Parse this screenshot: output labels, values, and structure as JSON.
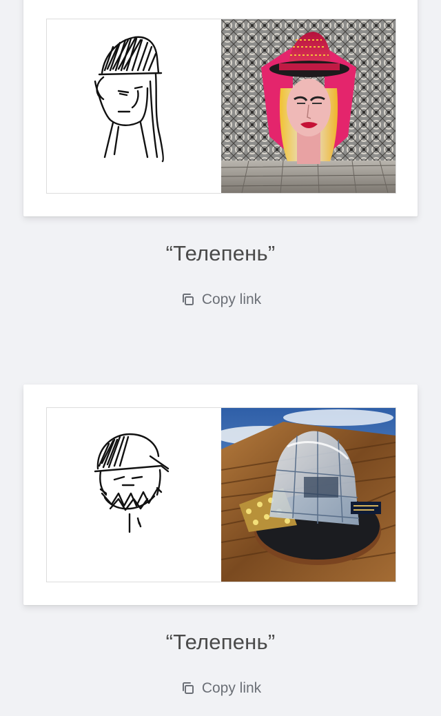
{
  "entries": [
    {
      "title": "“Телепень”",
      "copy_link_label": "Copy link",
      "sketch_icon": "hand-drawn-face-with-long-hair",
      "render_icon": "ornate-portrait-woman-red-hat"
    },
    {
      "title": "“Телепень”",
      "copy_link_label": "Copy link",
      "sketch_icon": "hand-drawn-bearded-face-with-cap",
      "render_icon": "glass-dome-sculpture-on-wood"
    }
  ],
  "colors": {
    "background": "#f1f2f5",
    "card": "#ffffff",
    "title_text": "#4a4a4a",
    "link_text": "#6b6f76"
  }
}
